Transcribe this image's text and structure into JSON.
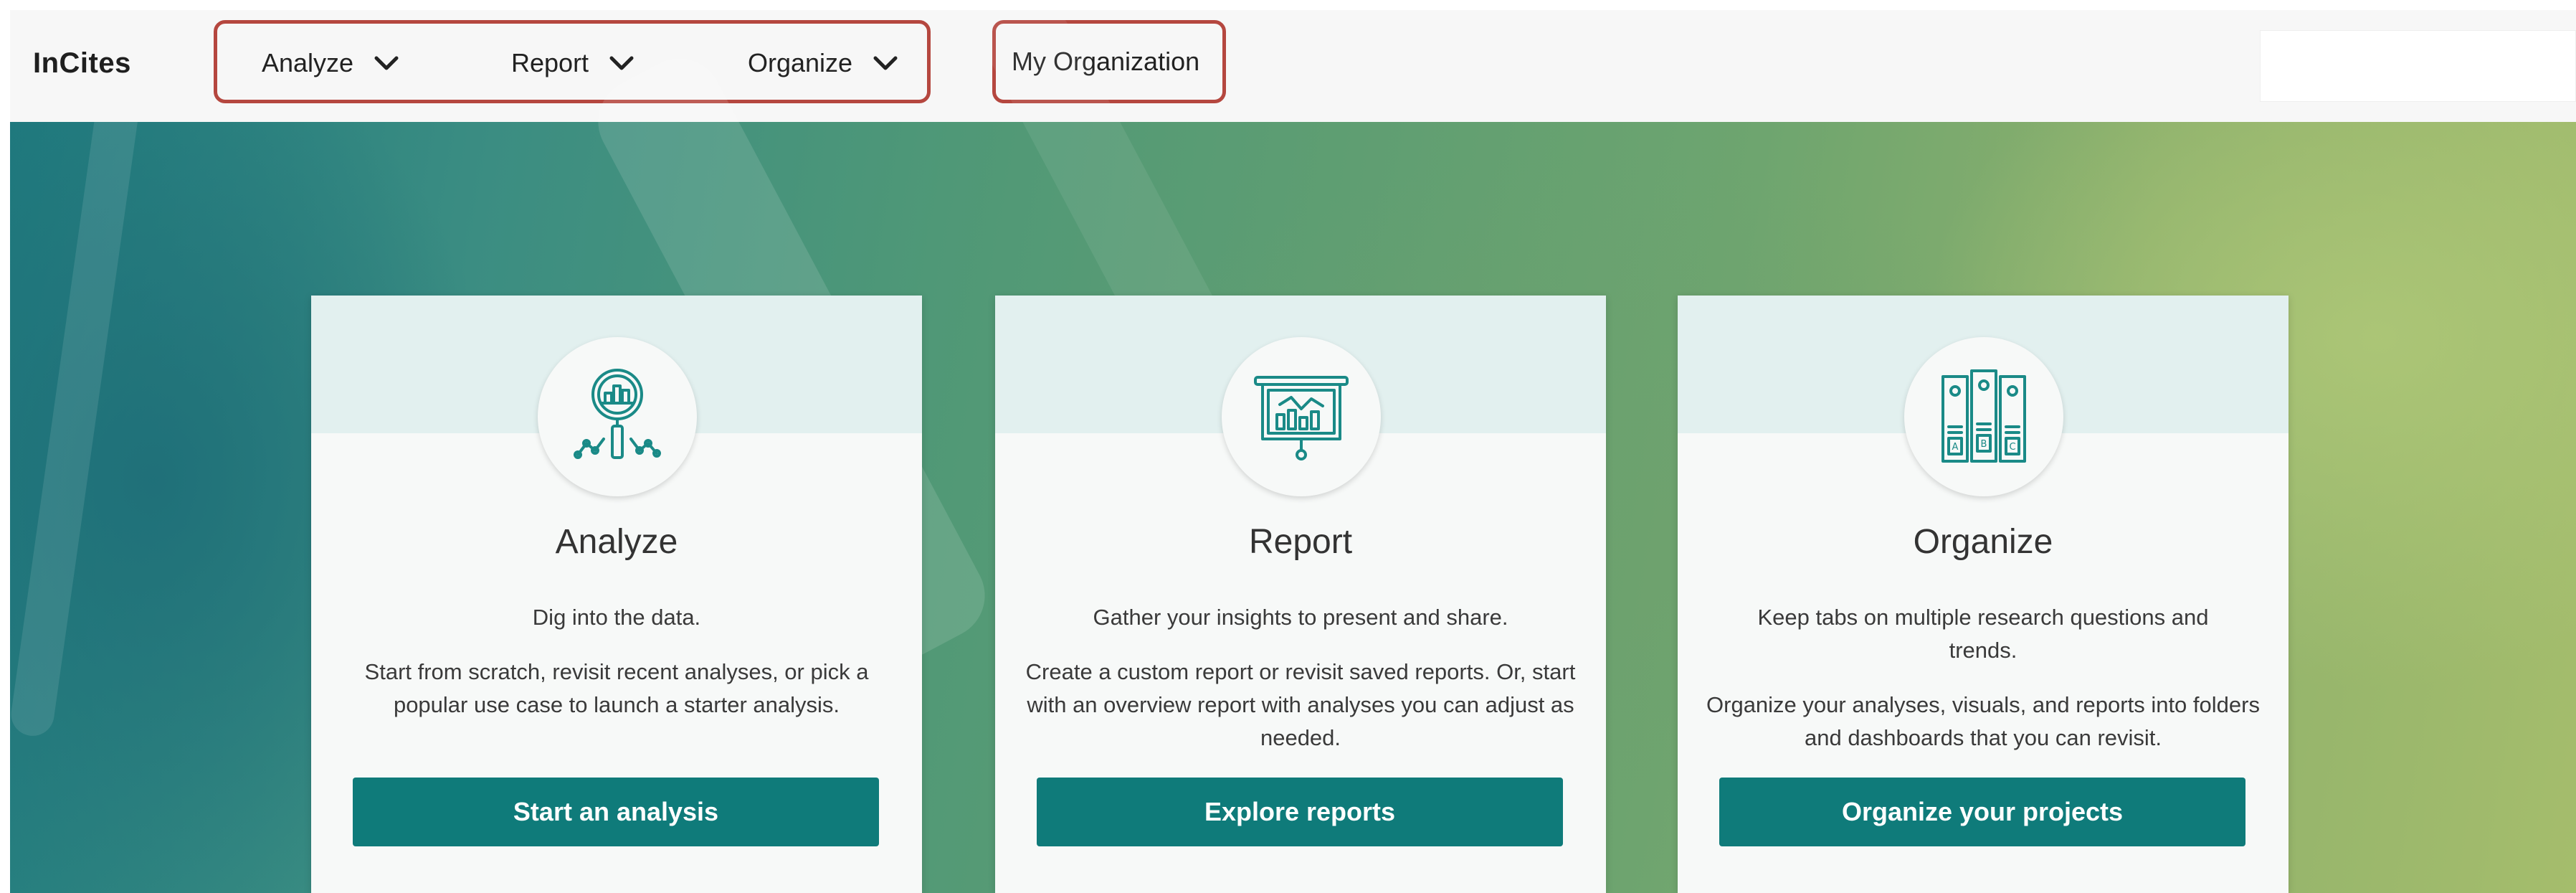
{
  "header": {
    "brand": "InCites",
    "nav": [
      {
        "label": "Analyze"
      },
      {
        "label": "Report"
      },
      {
        "label": "Organize"
      }
    ],
    "org_link": "My Organization"
  },
  "cards": [
    {
      "title": "Analyze",
      "subtitle": "Dig into the data.",
      "description": "Start from scratch, revisit recent analyses, or pick a popular use case to launch a starter analysis.",
      "button": "Start an analysis",
      "icon": "magnifier-chart-icon"
    },
    {
      "title": "Report",
      "subtitle": "Gather your insights to present and share.",
      "description": "Create a custom report or revisit saved reports. Or, start with an overview report with analyses you can adjust as needed.",
      "button": "Explore reports",
      "icon": "presentation-board-icon"
    },
    {
      "title": "Organize",
      "subtitle": "Keep tabs on multiple research questions and trends.",
      "description": "Organize your analyses, visuals, and reports into folders and dashboards that you can revisit.",
      "button": "Organize your projects",
      "icon": "binders-icon"
    }
  ],
  "colors": {
    "accent": "#0f7b7a",
    "highlight_border": "#b5473f",
    "icon_stroke": "#1a8a87"
  }
}
